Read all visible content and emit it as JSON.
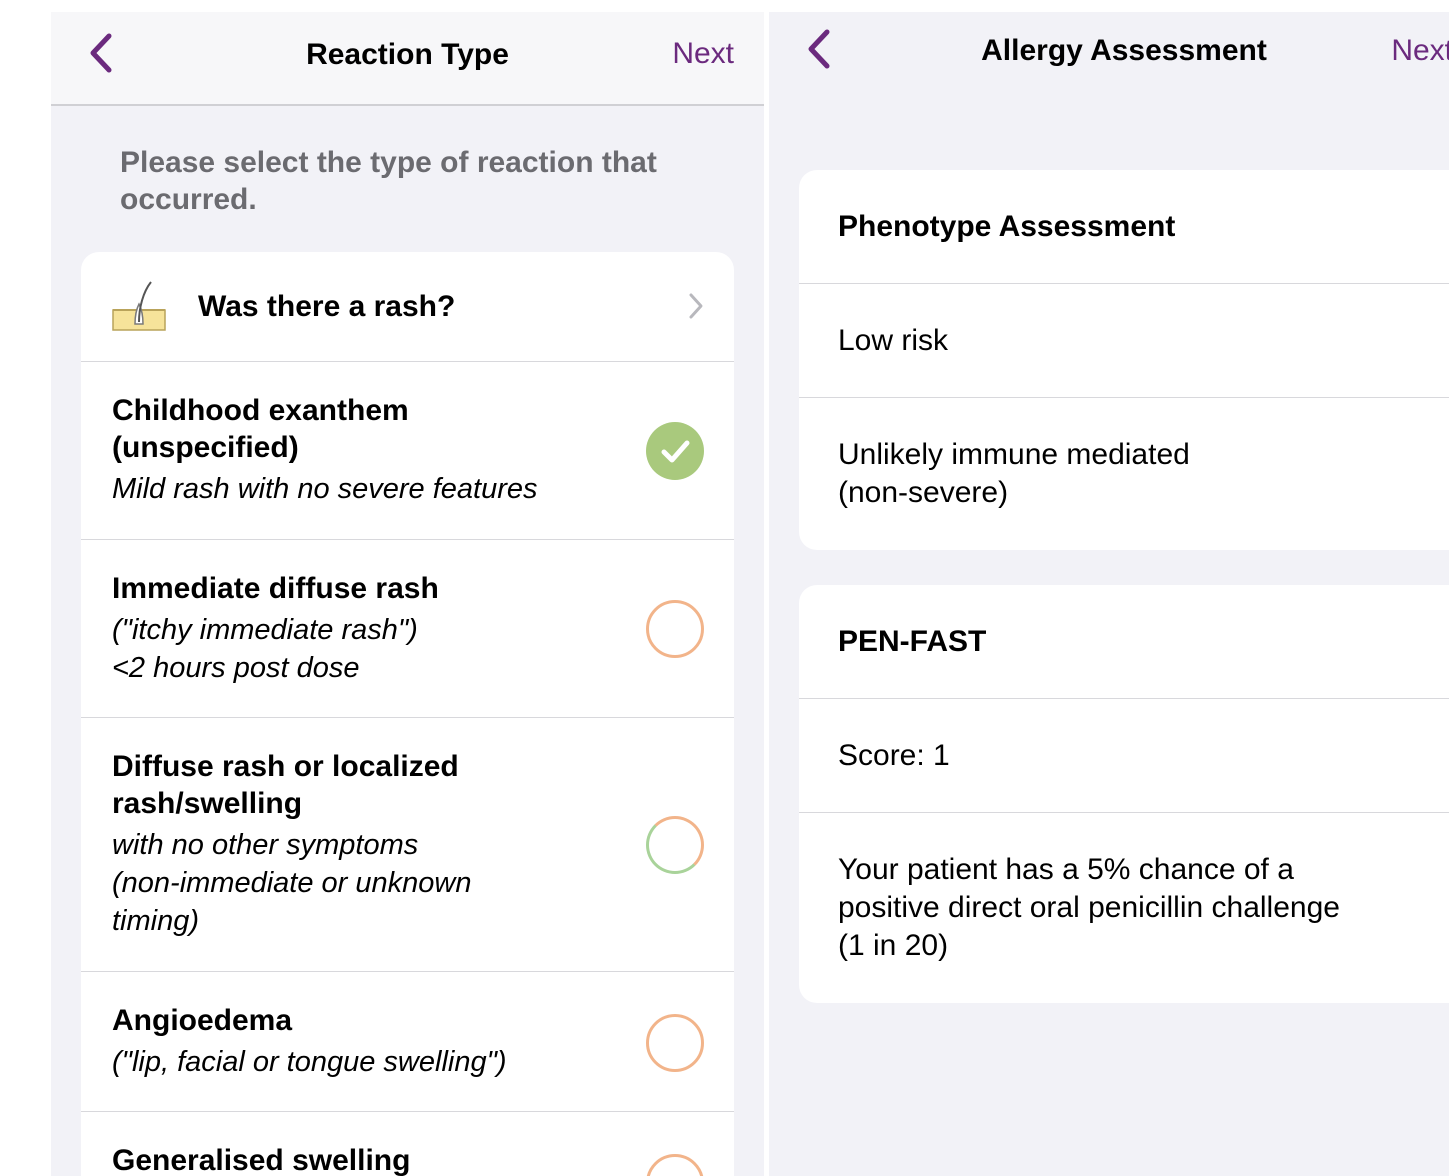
{
  "left": {
    "nav": {
      "title": "Reaction Type",
      "next_label": "Next"
    },
    "prompt": "Please select the type of reaction that occurred.",
    "rash_question": "Was there a rash?",
    "options": [
      {
        "title": "Childhood exanthem (unspecified)",
        "subtitle": "Mild rash with no severe features",
        "state": "selected"
      },
      {
        "title": "Immediate diffuse rash",
        "subtitle": "(\"itchy immediate rash\")\n<2 hours post dose",
        "state": "unselected"
      },
      {
        "title": "Diffuse rash or localized rash/swelling",
        "subtitle": "with no other symptoms (non-immediate or unknown timing)",
        "state": "unselected"
      },
      {
        "title": "Angioedema",
        "subtitle": "(\"lip, facial or tongue swelling\")",
        "state": "unselected"
      },
      {
        "title": "Generalised swelling",
        "subtitle": "",
        "state": "unselected"
      }
    ]
  },
  "right": {
    "nav": {
      "title": "Allergy Assessment",
      "next_label": "Next"
    },
    "phenotype": {
      "header": "Phenotype Assessment",
      "rows": [
        "Low risk",
        "Unlikely immune mediated\n(non-severe)"
      ]
    },
    "penfast": {
      "header": "PEN-FAST",
      "rows": [
        "Score: 1",
        "Your patient has a 5% chance of a positive direct oral penicillin challenge (1 in 20)"
      ]
    }
  },
  "colors": {
    "accent": "#6b2a7e",
    "selected_green": "#a9c97d",
    "radio_orange": "#f2b48a",
    "radio_mixed_green": "#a9d39a",
    "background": "#f2f2f7",
    "prompt_gray": "#6b6b70"
  },
  "icons": {
    "back": "chevron-left-icon",
    "rash": "skin-layer-icon",
    "disclosure": "chevron-right-icon",
    "selected": "checkmark-circle-icon",
    "unselected": "empty-circle-icon"
  }
}
